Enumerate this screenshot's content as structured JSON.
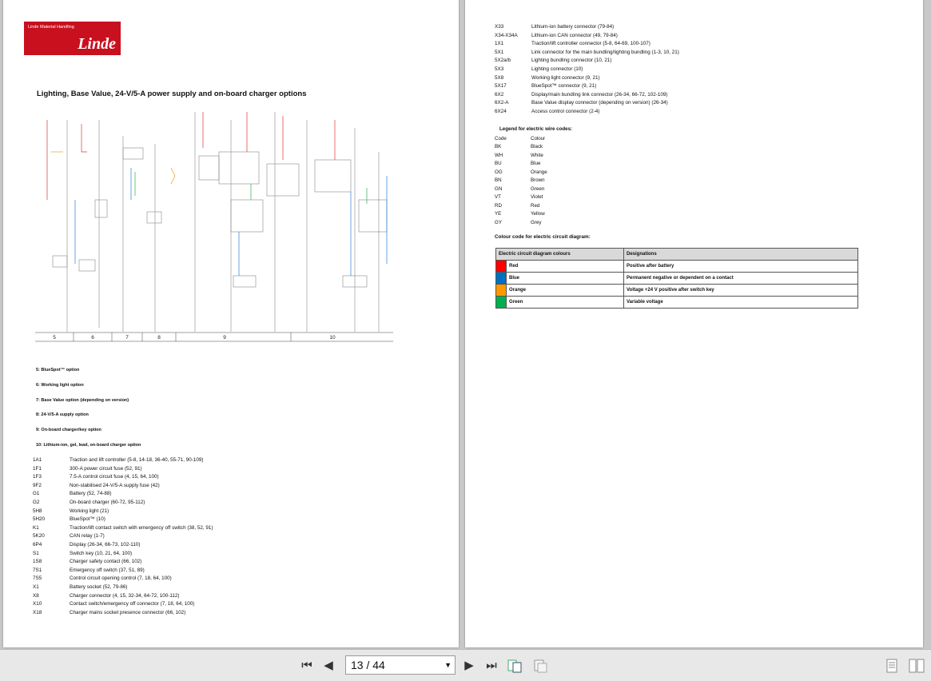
{
  "viewer": {
    "page_indicator": "13 / 44",
    "buttons": {
      "first": "⏮",
      "prev": "◀",
      "next": "▶",
      "last": "⏭"
    }
  },
  "logo": {
    "small": "Linde Material Handling",
    "big": "Linde"
  },
  "left_page": {
    "title": "Lighting, Base Value, 24-V/5-A power supply and on-board charger options",
    "section_numbers": [
      "5",
      "6",
      "7",
      "8",
      "9",
      "10"
    ],
    "options": [
      "5: BlueSpot™ option",
      "6: Working light option",
      "7: Base Value option (depending on version)",
      "8: 24-V/5-A supply option",
      "9: On-board charger/key option",
      "10: Lithium-ion, gel, lead, on-board charger option"
    ],
    "legend": [
      {
        "code": "1A1",
        "desc": "Traction and lift controller (5-8, 14-18, 36-40, 55-71, 90-109)"
      },
      {
        "code": "1F1",
        "desc": "300-A power circuit fuse (52, 91)"
      },
      {
        "code": "1F3",
        "desc": "7.5-A control circuit fuse (4, 15, 64, 100)"
      },
      {
        "code": "9F2",
        "desc": "Non-stabilised 24-V/5-A supply fuse (42)"
      },
      {
        "code": "G1",
        "desc": "Battery (52, 74-88)"
      },
      {
        "code": "G2",
        "desc": "On-board charger (60-72, 95-112)"
      },
      {
        "code": "5H8",
        "desc": "Working light (21)"
      },
      {
        "code": "5H20",
        "desc": "BlueSpot™ (10)"
      },
      {
        "code": "K1",
        "desc": "Traction/lift contact switch with emergency off switch (38, 52, 91)"
      },
      {
        "code": "5K20",
        "desc": "CAN relay (1-7)"
      },
      {
        "code": "6P4",
        "desc": "Display (26-34, 66-73, 102-110)"
      },
      {
        "code": "S1",
        "desc": "Switch key (10, 21, 64, 100)"
      },
      {
        "code": "1S8",
        "desc": "Charger safety contact (66, 102)"
      },
      {
        "code": "7S1",
        "desc": "Emergency off switch (37, 51, 89)"
      },
      {
        "code": "7S5",
        "desc": "Control circuit opening control (7, 18, 64, 100)"
      },
      {
        "code": "X1",
        "desc": "Battery socket (52, 79-86)"
      },
      {
        "code": "X8",
        "desc": "Charger connector (4, 15, 32-34, 64-72, 100-112)"
      },
      {
        "code": "X10",
        "desc": "Contact switch/emergency off connector (7, 18, 64, 100)"
      },
      {
        "code": "X18",
        "desc": "Charger mains socket presence connector (66, 102)"
      }
    ]
  },
  "right_page": {
    "legend": [
      {
        "code": "X33",
        "desc": "Lithium-ion battery connector (79-84)"
      },
      {
        "code": "X34-X34A",
        "desc": "Lithium-ion CAN connector (49, 79-84)"
      },
      {
        "code": "1X1",
        "desc": "Traction/lift controller connector (5-8, 64-69, 100-107)"
      },
      {
        "code": "5X1",
        "desc": "Link connector for the main bundling/lighting bundling (1-3, 10, 21)"
      },
      {
        "code": "5X2a/b",
        "desc": "Lighting bundling connector (10, 21)"
      },
      {
        "code": "5X3",
        "desc": "Lighting connector (10)"
      },
      {
        "code": "5X8",
        "desc": "Working light connector (9, 21)"
      },
      {
        "code": "5X17",
        "desc": "BlueSpot™ connector (9, 21)"
      },
      {
        "code": "6X2",
        "desc": "Display/main bundling link connector (26-34, 66-72, 102-109)"
      },
      {
        "code": "6X2-A",
        "desc": "Base Value display connector (depending on version) (26-34)"
      },
      {
        "code": "6X24",
        "desc": "Access control connector (2-4)"
      }
    ],
    "wire_legend_title": "Legend for electric wire codes:",
    "wire_header": {
      "code": "Code",
      "colour": "Colour"
    },
    "wire_codes": [
      {
        "code": "BK",
        "colour": "Black"
      },
      {
        "code": "WH",
        "colour": "White"
      },
      {
        "code": "BU",
        "colour": "Blue"
      },
      {
        "code": "OG",
        "colour": "Orange"
      },
      {
        "code": "BN",
        "colour": "Brown"
      },
      {
        "code": "GN",
        "colour": "Green"
      },
      {
        "code": "VT",
        "colour": "Violet"
      },
      {
        "code": "RD",
        "colour": "Red"
      },
      {
        "code": "YE",
        "colour": "Yellow"
      },
      {
        "code": "GY",
        "colour": "Grey"
      }
    ],
    "colour_code_title": "Colour code for electric circuit diagram:",
    "colour_table": {
      "headers": [
        "Electric circuit diagram colours",
        "Designations"
      ],
      "rows": [
        {
          "swatch": "#ff0000",
          "colour": "Red",
          "designation": "Positive after battery"
        },
        {
          "swatch": "#0070c0",
          "colour": "Blue",
          "designation": "Permanent negative or dependent on a contact"
        },
        {
          "swatch": "#ff9900",
          "colour": "Orange",
          "designation": "Voltage +24 V positive after switch key"
        },
        {
          "swatch": "#00b050",
          "colour": "Green",
          "designation": "Variable voltage"
        }
      ]
    }
  }
}
